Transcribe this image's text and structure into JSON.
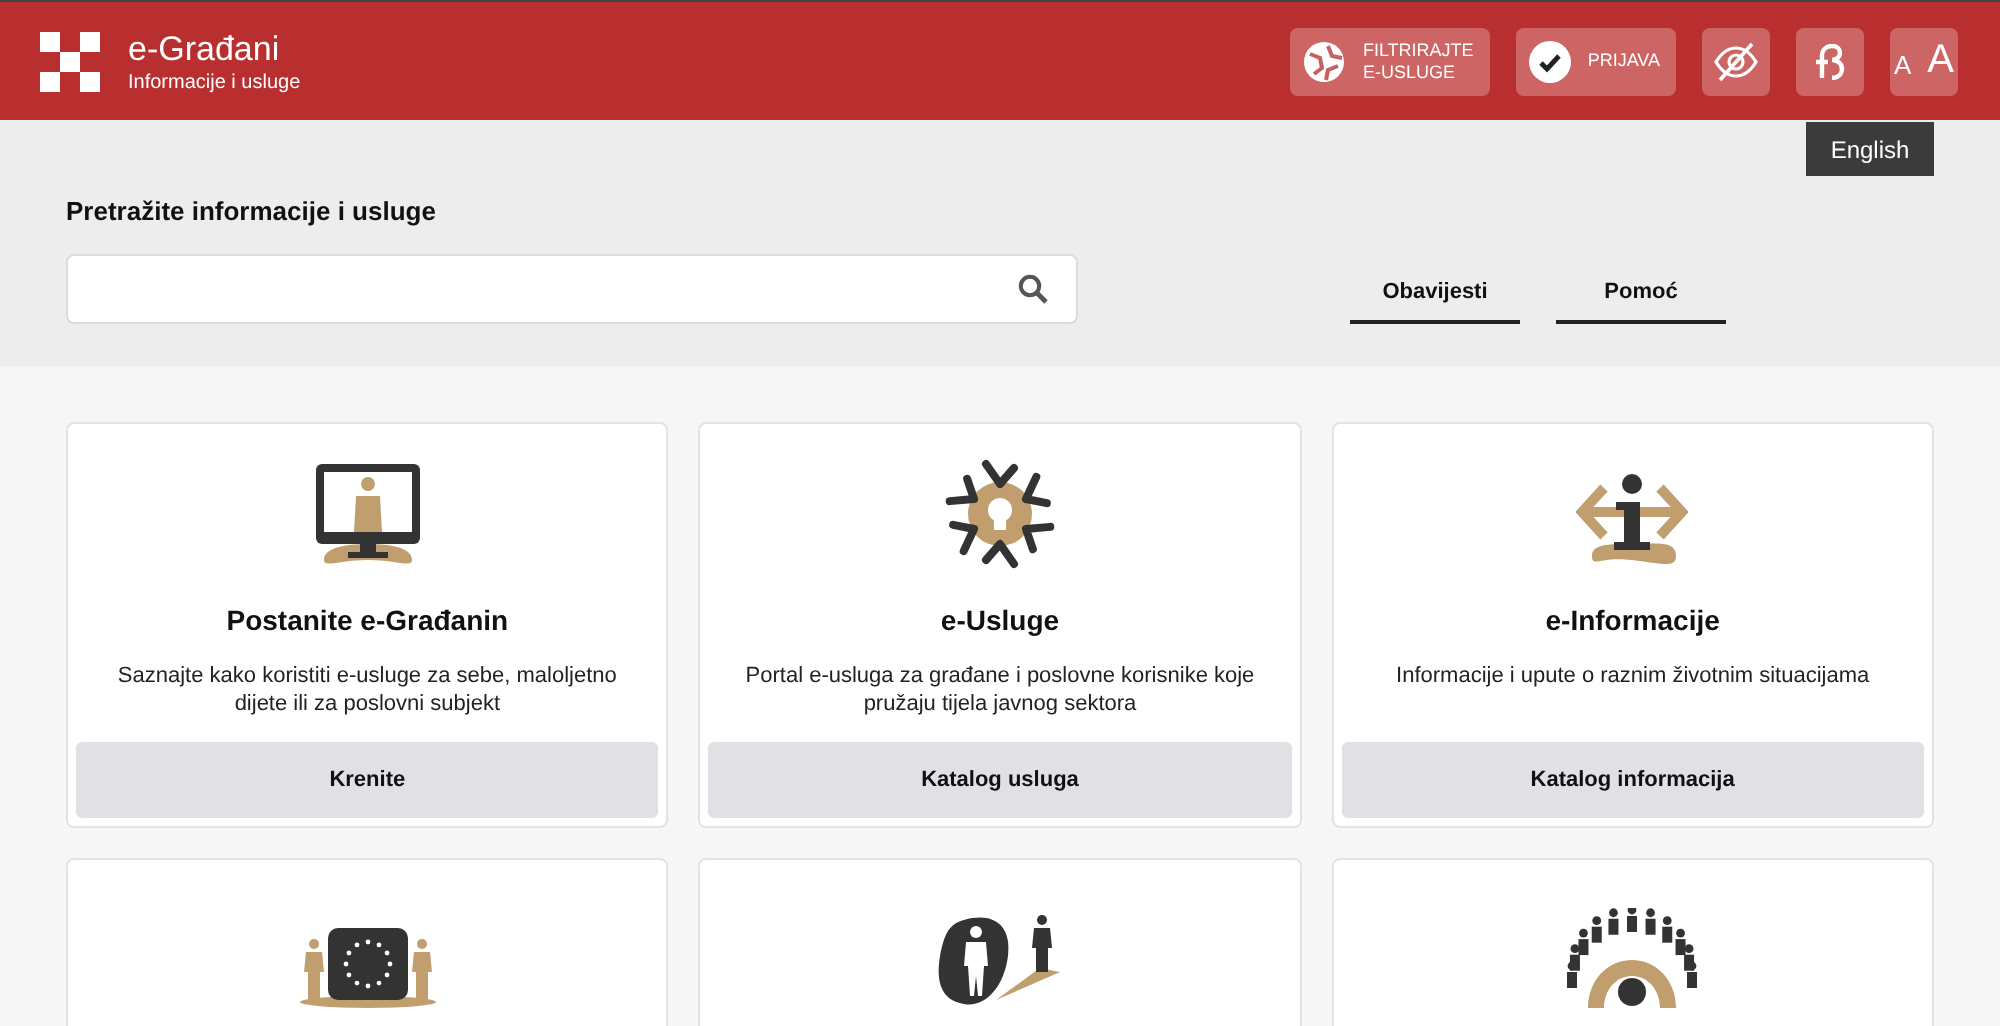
{
  "header": {
    "title": "e-Građani",
    "subtitle": "Informacije i usluge",
    "buttons": [
      {
        "kind": "filter",
        "lines": [
          "FILTRIRAJTE",
          "E-USLUGE"
        ]
      },
      {
        "kind": "login",
        "lines": [
          "PRIJAVA"
        ]
      },
      {
        "kind": "contrast"
      },
      {
        "kind": "font"
      },
      {
        "kind": "size",
        "lines": [
          "A",
          "A"
        ]
      }
    ]
  },
  "language_tooltip": "English",
  "search": {
    "label": "Pretražite informacije i usluge"
  },
  "links": [
    "Obavijesti",
    "Pomoć"
  ],
  "cards": [
    {
      "kind": "full",
      "title": "Postanite e-Građanin",
      "description": "Saznajte kako koristiti e-usluge za sebe, maloljetno dijete ili za poslovni subjekt",
      "button": "Krenite"
    },
    {
      "kind": "full",
      "title": "e-Usluge",
      "description": "Portal e-usluga za građane i poslovne korisnike koje pružaju tijela javnog sektora",
      "button": "Katalog usluga"
    },
    {
      "kind": "full",
      "title": "e-Informacije",
      "description": "Informacije i upute o raznim životnim situacijama",
      "button": "Katalog informacija"
    },
    {
      "kind": "cut"
    },
    {
      "kind": "cut"
    },
    {
      "kind": "cut"
    }
  ]
}
